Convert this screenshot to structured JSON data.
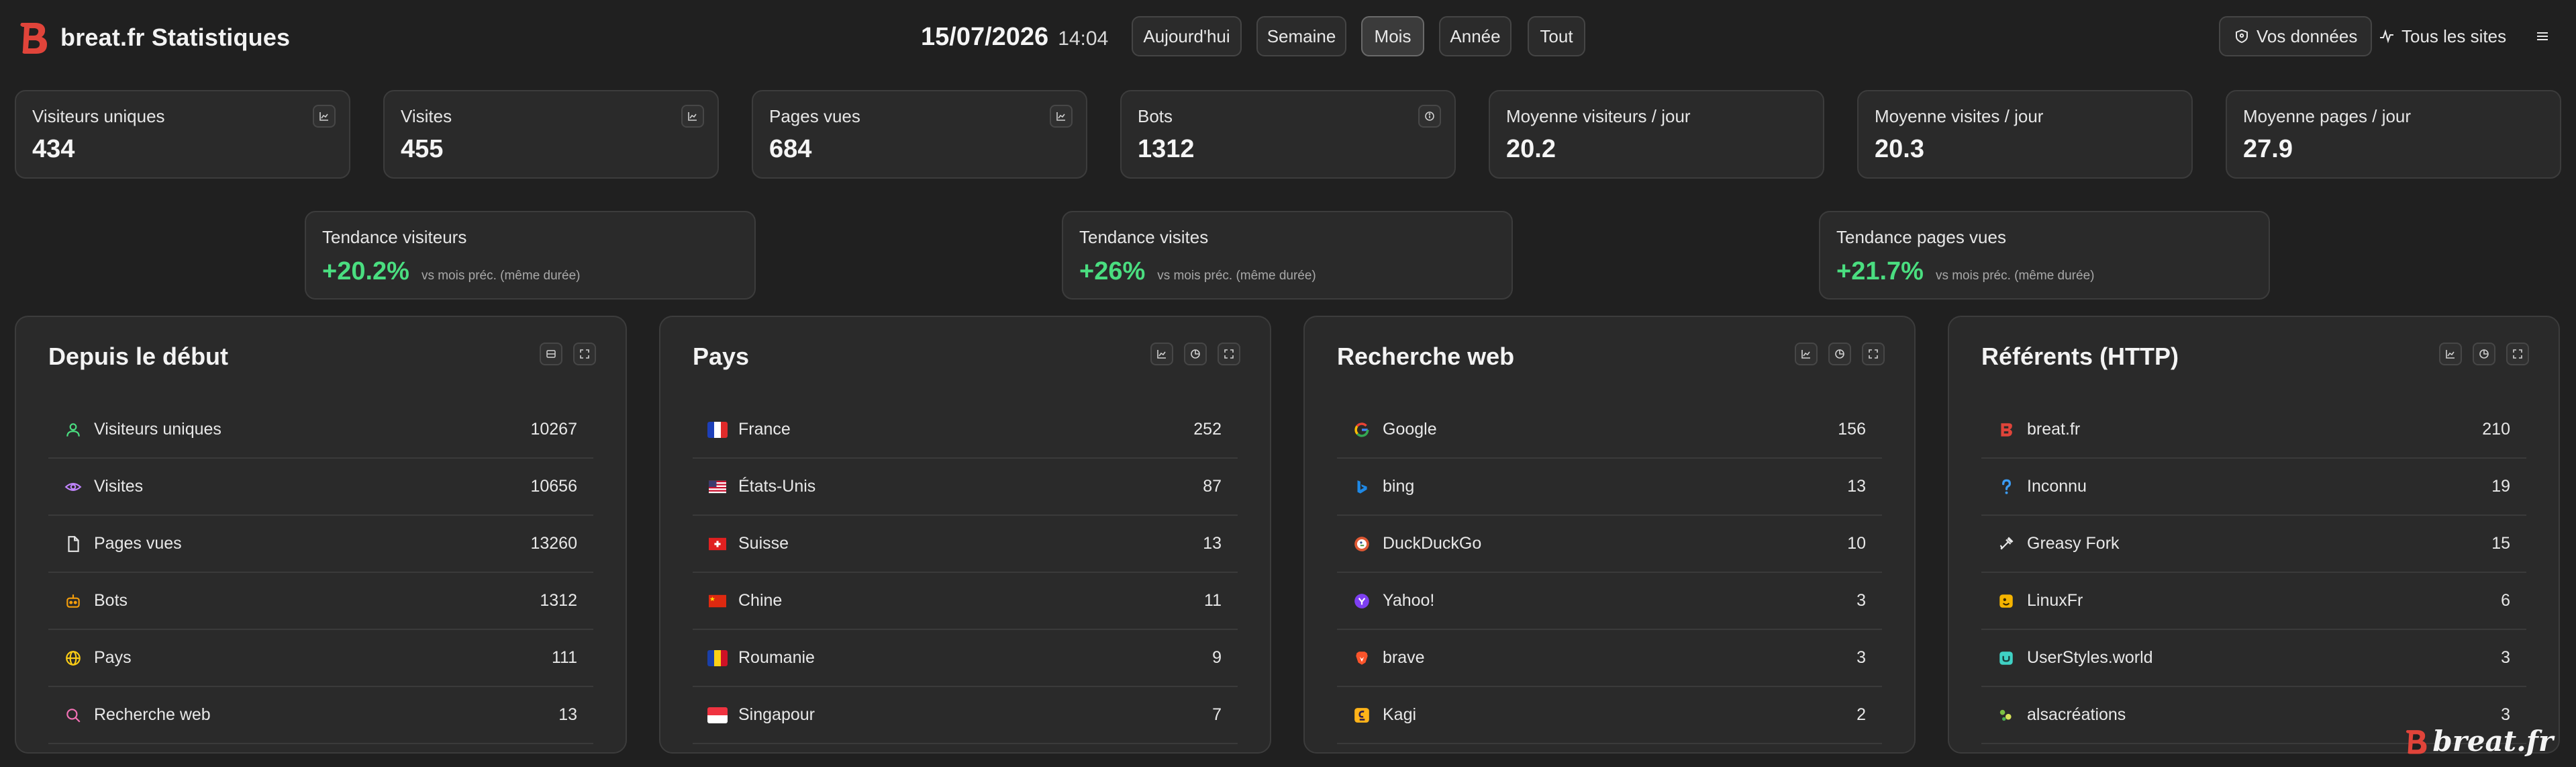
{
  "header": {
    "title": "breat.fr Statistiques",
    "date": "15/07/2026",
    "time": "14:04",
    "ranges": [
      "Aujourd'hui",
      "Semaine",
      "Mois",
      "Année",
      "Tout"
    ],
    "active_range": "Mois",
    "your_data": "Vos données",
    "all_sites": "Tous les sites",
    "menu_icon": "hamburger-icon"
  },
  "stats": [
    {
      "label": "Visiteurs uniques",
      "value": "434",
      "icon": "chart-icon"
    },
    {
      "label": "Visites",
      "value": "455",
      "icon": "chart-icon"
    },
    {
      "label": "Pages vues",
      "value": "684",
      "icon": "chart-icon"
    },
    {
      "label": "Bots",
      "value": "1312",
      "icon": "info-icon"
    },
    {
      "label": "Moyenne visiteurs / jour",
      "value": "20.2"
    },
    {
      "label": "Moyenne visites / jour",
      "value": "20.3"
    },
    {
      "label": "Moyenne pages / jour",
      "value": "27.9"
    }
  ],
  "trends": [
    {
      "label": "Tendance visiteurs",
      "value": "+20.2%",
      "note": "vs mois préc. (même durée)"
    },
    {
      "label": "Tendance visites",
      "value": "+26%",
      "note": "vs mois préc. (même durée)"
    },
    {
      "label": "Tendance pages vues",
      "value": "+21.7%",
      "note": "vs mois préc. (même durée)"
    }
  ],
  "panels": {
    "since_start": {
      "title": "Depuis le début",
      "rows": [
        {
          "label": "Visiteurs uniques",
          "value": "10267",
          "icon": "user-icon",
          "color": "#4ade80"
        },
        {
          "label": "Visites",
          "value": "10656",
          "icon": "eye-icon",
          "color": "#c084fc"
        },
        {
          "label": "Pages vues",
          "value": "13260",
          "icon": "file-icon",
          "color": "#e5e5e5"
        },
        {
          "label": "Bots",
          "value": "1312",
          "icon": "bot-icon",
          "color": "#f59e0b"
        },
        {
          "label": "Pays",
          "value": "111",
          "icon": "globe-icon",
          "color": "#facc15"
        },
        {
          "label": "Recherche web",
          "value": "13",
          "icon": "search-icon",
          "color": "#f472b6"
        }
      ]
    },
    "countries": {
      "title": "Pays",
      "rows": [
        {
          "label": "France",
          "value": "252"
        },
        {
          "label": "États-Unis",
          "value": "87"
        },
        {
          "label": "Suisse",
          "value": "13"
        },
        {
          "label": "Chine",
          "value": "11"
        },
        {
          "label": "Roumanie",
          "value": "9"
        },
        {
          "label": "Singapour",
          "value": "7"
        }
      ]
    },
    "web_search": {
      "title": "Recherche web",
      "rows": [
        {
          "label": "Google",
          "value": "156",
          "icon": "google-icon"
        },
        {
          "label": "bing",
          "value": "13",
          "icon": "bing-icon"
        },
        {
          "label": "DuckDuckGo",
          "value": "10",
          "icon": "duckduckgo-icon"
        },
        {
          "label": "Yahoo!",
          "value": "3",
          "icon": "yahoo-icon"
        },
        {
          "label": "brave",
          "value": "3",
          "icon": "brave-icon"
        },
        {
          "label": "Kagi",
          "value": "2",
          "icon": "kagi-icon"
        }
      ]
    },
    "referrers": {
      "title": "Référents (HTTP)",
      "rows": [
        {
          "label": "breat.fr",
          "value": "210",
          "icon": "breat-logo-icon"
        },
        {
          "label": "Inconnu",
          "value": "19",
          "icon": "question-icon"
        },
        {
          "label": "Greasy Fork",
          "value": "15",
          "icon": "greasyfork-icon"
        },
        {
          "label": "LinuxFr",
          "value": "6",
          "icon": "linuxfr-icon"
        },
        {
          "label": "UserStyles.world",
          "value": "3",
          "icon": "userstyles-icon"
        },
        {
          "label": "alsacréations",
          "value": "3",
          "icon": "alsacreations-icon"
        }
      ]
    }
  },
  "watermark": "breat.fr"
}
